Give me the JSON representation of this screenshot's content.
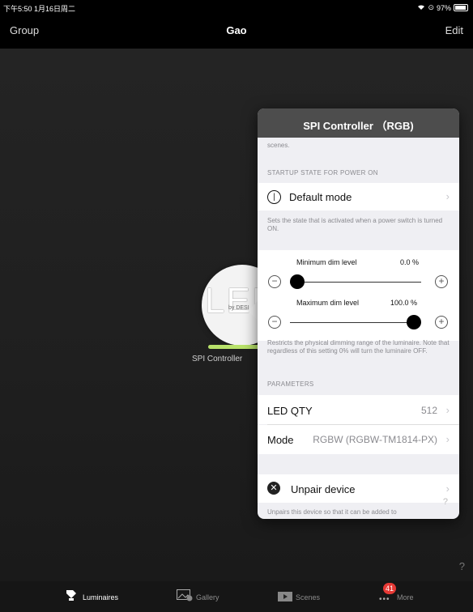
{
  "status": {
    "time": "下午5:50  1月16日周二",
    "battery": "97%"
  },
  "nav": {
    "left": "Group",
    "title": "Gao",
    "right": "Edit"
  },
  "luminaire": {
    "label": "SPI Controller",
    "logo_text": "LED",
    "logo_sub": "by DESI"
  },
  "popover": {
    "title": "SPI Controller （RGB)",
    "top_note": "scenes.",
    "startup_section": "STARTUP STATE FOR POWER ON",
    "default_mode_label": "Default mode",
    "default_mode_note": "Sets the state that is activated when a power switch is turned ON.",
    "min_dim_label": "Minimum dim level",
    "min_dim_value": "0.0 %",
    "min_dim_fraction": 0.0,
    "max_dim_label": "Maximum dim level",
    "max_dim_value": "100.0 %",
    "max_dim_fraction": 1.0,
    "dim_note": "Restricts the physical dimming range of the luminaire. Note that regardless of this setting 0% will turn the luminaire OFF.",
    "parameters_section": "PARAMETERS",
    "led_qty_label": "LED QTY",
    "led_qty_value": "512",
    "mode_label": "Mode",
    "mode_value": "RGBW (RGBW-TM1814-PX)",
    "unpair_label": "Unpair device",
    "unpair_note": "Unpairs this device so that it can be added to"
  },
  "help": "?",
  "tabs": [
    {
      "label": "Luminaires",
      "icon": "luminaire-icon"
    },
    {
      "label": "Gallery",
      "icon": "gallery-icon"
    },
    {
      "label": "Scenes",
      "icon": "scenes-icon"
    },
    {
      "label": "More",
      "icon": "more-icon",
      "badge": "41"
    }
  ],
  "colors": {
    "accent_green": "#b8e26a",
    "badge_red": "#e53935",
    "popover_header": "#4d4d4d"
  }
}
